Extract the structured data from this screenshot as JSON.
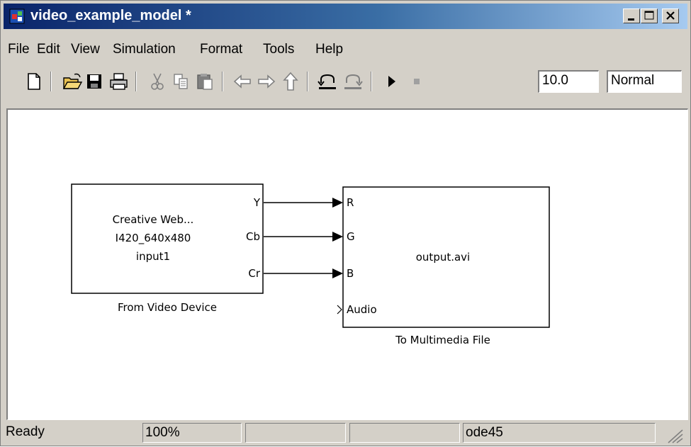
{
  "window": {
    "title": "video_example_model *"
  },
  "menu": [
    "File",
    "Edit",
    "View",
    "Simulation",
    "Format",
    "Tools",
    "Help"
  ],
  "toolbar": {
    "stop_time": "10.0",
    "sim_mode": "Normal",
    "icons": [
      "new-model-icon",
      "open-icon",
      "save-icon",
      "print-icon",
      "cut-icon",
      "copy-icon",
      "paste-icon",
      "back-icon",
      "forward-icon",
      "up-icon",
      "undo-icon",
      "redo-icon",
      "start-icon",
      "stop-icon"
    ]
  },
  "diagram": {
    "source_block": {
      "line1": "Creative Web...",
      "line2": "I420_640x480",
      "line3": "input1",
      "ports": [
        "Y",
        "Cb",
        "Cr"
      ],
      "caption": "From Video Device"
    },
    "sink_block": {
      "content": "output.avi",
      "ports": [
        "R",
        "G",
        "B",
        "Audio"
      ],
      "caption": "To Multimedia File"
    }
  },
  "status": {
    "state": "Ready",
    "zoom": "100%",
    "blank1": "",
    "blank2": "",
    "solver": "ode45"
  }
}
